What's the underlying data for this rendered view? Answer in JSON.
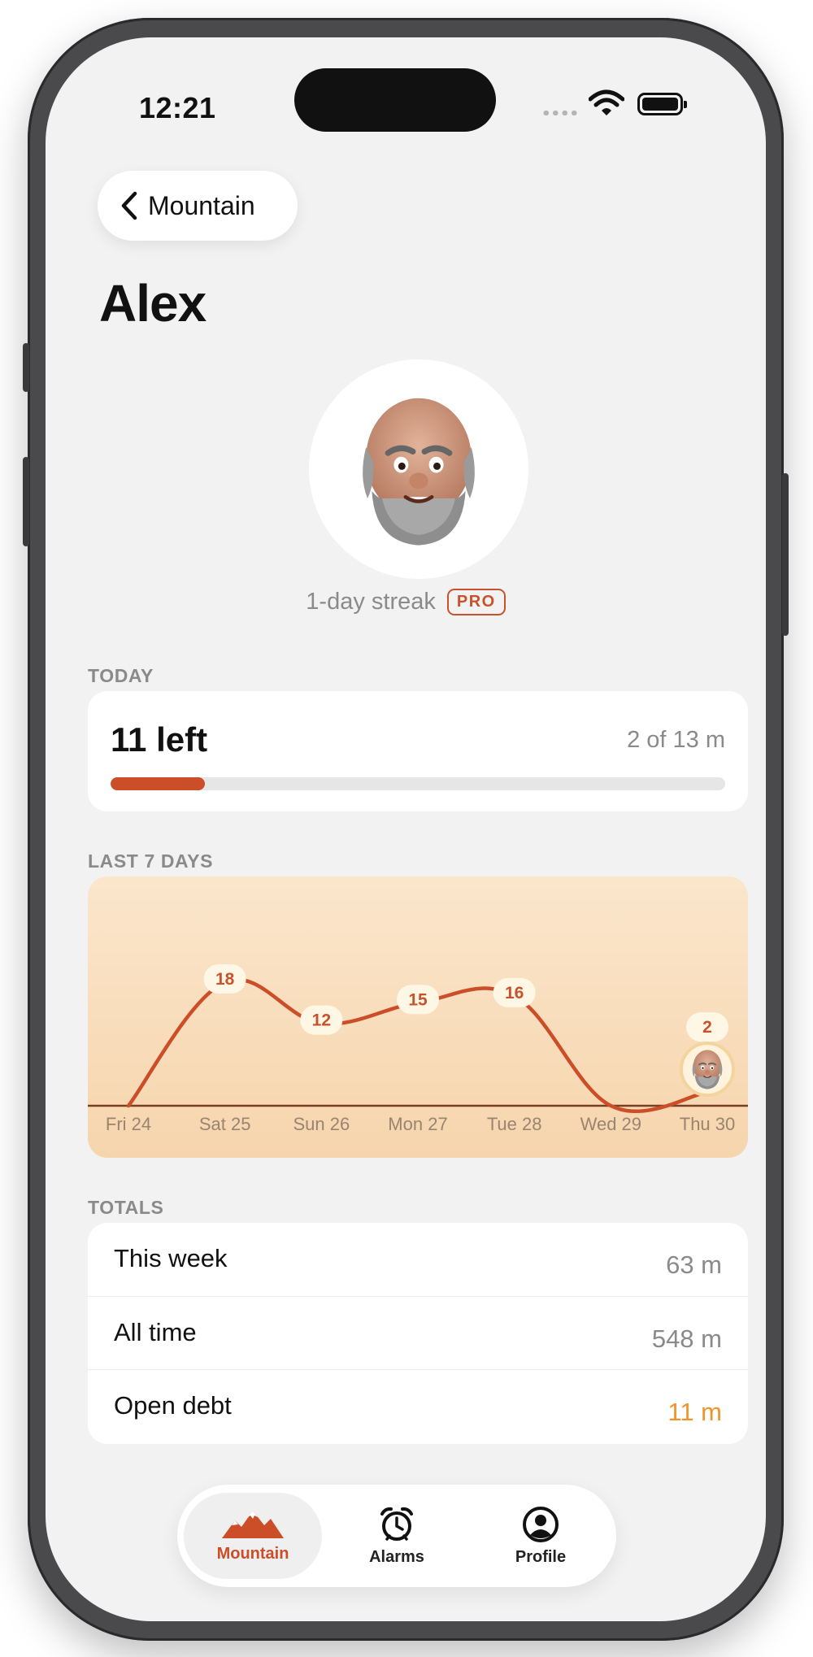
{
  "status_bar": {
    "time": "12:21"
  },
  "nav": {
    "back_label": "Mountain"
  },
  "page": {
    "title": "Alex"
  },
  "profile": {
    "streak_text": "1-day streak",
    "badge": "PRO"
  },
  "today": {
    "section_label": "TODAY",
    "left_text": "11 left",
    "progress_text": "2 of 13 m",
    "progress_fraction": 0.154
  },
  "last7": {
    "section_label": "LAST 7 DAYS"
  },
  "chart_data": {
    "type": "line",
    "categories": [
      "Fri 24",
      "Sat 25",
      "Sun 26",
      "Mon 27",
      "Tue 28",
      "Wed 29",
      "Thu 30"
    ],
    "series": [
      {
        "values": [
          0,
          18,
          12,
          15,
          16,
          0,
          2
        ]
      }
    ],
    "data_labels": [
      "",
      "18",
      "12",
      "15",
      "16",
      "",
      "2"
    ],
    "line_color": "#cc4e28",
    "last_point_marker": "avatar",
    "grid": false
  },
  "totals": {
    "section_label": "TOTALS",
    "rows": [
      {
        "label": "This week",
        "value": "63 m"
      },
      {
        "label": "All time",
        "value": "548 m"
      },
      {
        "label": "Open debt",
        "value": "11 m",
        "color": "#f0932b"
      }
    ]
  },
  "tabbar": {
    "tabs": [
      {
        "label": "Mountain",
        "icon": "mountain-icon",
        "active": true
      },
      {
        "label": "Alarms",
        "icon": "alarm-clock-icon",
        "active": false
      },
      {
        "label": "Profile",
        "icon": "person-circle-icon",
        "active": false
      }
    ]
  },
  "colors": {
    "accent": "#cc4e28",
    "background": "#f2f2f2",
    "debt": "#f0932b"
  }
}
